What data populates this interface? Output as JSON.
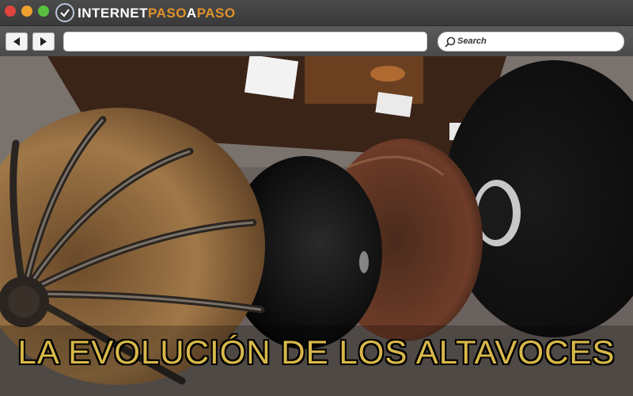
{
  "window": {
    "brand": {
      "part1": "INTERNET",
      "part2": "PASO",
      "part3": "A",
      "part4": "PASO"
    },
    "colors": {
      "accent": "#e0922a",
      "close": "#e0443e",
      "minimize": "#f0a030",
      "maximize": "#58c040"
    }
  },
  "toolbar": {
    "back_icon": "arrow-left-icon",
    "forward_icon": "arrow-right-icon",
    "url_value": "",
    "search_placeholder": "Search"
  },
  "hero": {
    "headline": "LA EVOLUCIÓN DE LOS ALTAVOCES",
    "headline_color": "#d8b84a",
    "image_subject": "antique-horn-loudspeakers"
  }
}
